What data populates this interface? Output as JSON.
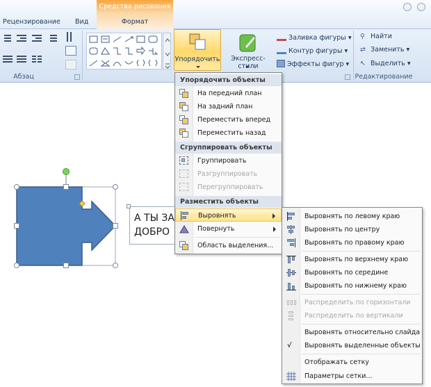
{
  "ribbon": {
    "tabs": {
      "review": "Рецензирование",
      "view": "Вид"
    },
    "contextual": {
      "title": "Средства рисования",
      "tab": "Формат"
    },
    "groups": {
      "paragraph": "Абзац",
      "editing": "Редактирование"
    },
    "arrange_button": "Упорядочить",
    "express_styles_button": "Экспресс-стили",
    "shape_fill": "Заливка фигуры",
    "shape_outline": "Контур фигуры",
    "shape_effects": "Эффекты фигур",
    "find": "Найти",
    "replace": "Заменить",
    "select": "Выделить"
  },
  "document": {
    "text_line1": "А ТЫ ЗА",
    "text_line2": "ДОБРО"
  },
  "arrange_menu": {
    "header_order": "Упорядочить объекты",
    "bring_front": "На передний план",
    "send_back": "На задний план",
    "bring_forward": "Переместить вперед",
    "send_backward": "Переместить назад",
    "header_group": "Сгруппировать объекты",
    "group": "Группировать",
    "ungroup": "Разгруппировать",
    "regroup": "Перегруппировать",
    "header_place": "Разместить объекты",
    "align": "Выровнять",
    "rotate": "Повернуть",
    "selection_pane": "Область выделения..."
  },
  "align_menu": {
    "left": "Выровнять по левому краю",
    "center": "Выровнять по центру",
    "right": "Выровнять по правому краю",
    "top": "Выровнять по верхнему краю",
    "middle": "Выровнять по середине",
    "bottom": "Выровнять по нижнему краю",
    "dist_h": "Распределить по горизонтали",
    "dist_v": "Распределить по вертикали",
    "rel_slide": "Выровнять относительно слайда",
    "rel_selected": "Выровнять выделенные объекты",
    "rel_selected_checked": "√",
    "show_grid": "Отображать сетку",
    "grid_settings": "Параметры сетки..."
  },
  "colors": {
    "shape_fill": "#4f81bd",
    "shape_border": "#385d8a",
    "highlight": "#ffe38a",
    "contextual": "#f7a63c"
  }
}
